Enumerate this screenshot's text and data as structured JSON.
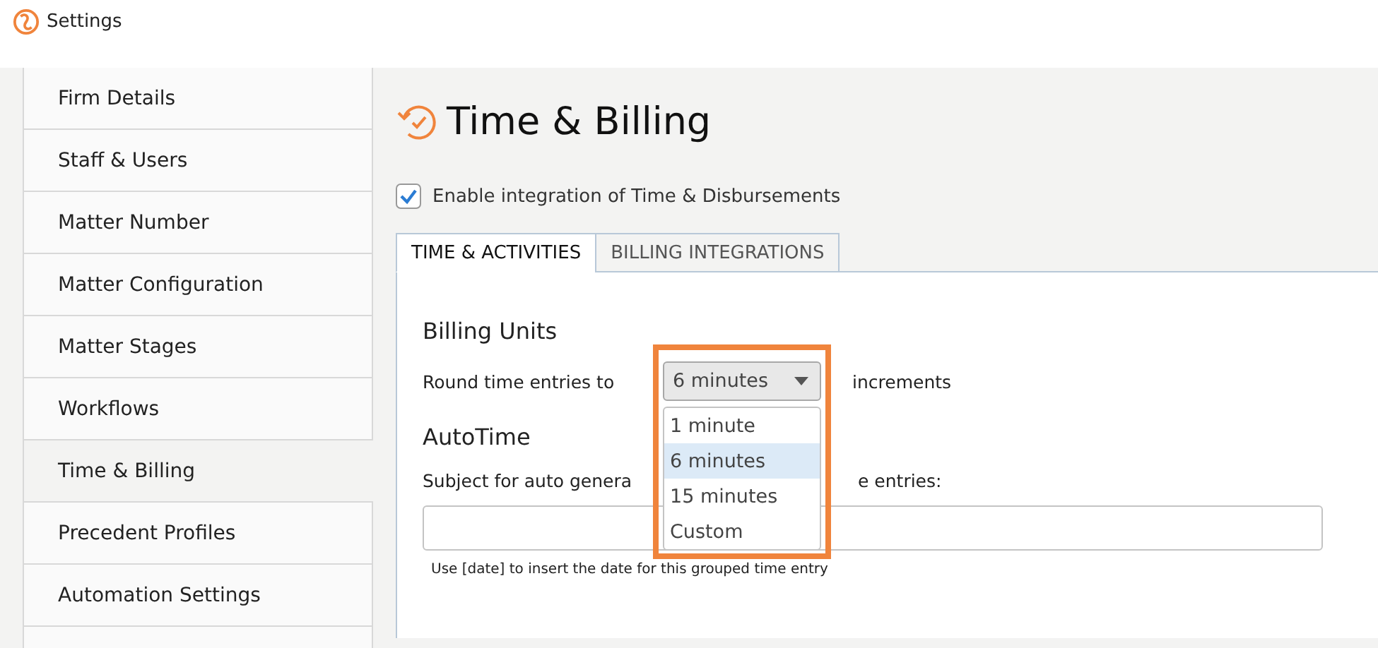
{
  "window": {
    "title": "Settings"
  },
  "sidebar": {
    "items": [
      {
        "label": "Firm Details",
        "selected": false
      },
      {
        "label": "Staff & Users",
        "selected": false
      },
      {
        "label": "Matter Number",
        "selected": false
      },
      {
        "label": "Matter Configuration",
        "selected": false
      },
      {
        "label": "Matter Stages",
        "selected": false
      },
      {
        "label": "Workflows",
        "selected": false
      },
      {
        "label": "Time & Billing",
        "selected": true
      },
      {
        "label": "Precedent Profiles",
        "selected": false
      },
      {
        "label": "Automation Settings",
        "selected": false
      }
    ]
  },
  "page": {
    "title": "Time & Billing",
    "enable_checkbox": {
      "label": "Enable integration of Time & Disbursements",
      "checked": true
    }
  },
  "tabs": [
    {
      "label": "TIME & ACTIVITIES",
      "selected": true
    },
    {
      "label": "BILLING INTEGRATIONS",
      "selected": false
    }
  ],
  "billing_units": {
    "heading": "Billing Units",
    "label_before": "Round time entries to",
    "label_after": "increments",
    "select": {
      "value": "6 minutes",
      "expanded": true,
      "options": [
        {
          "label": "1 minute",
          "selected": false
        },
        {
          "label": "6 minutes",
          "selected": true
        },
        {
          "label": "15 minutes",
          "selected": false
        },
        {
          "label": "Custom",
          "selected": false
        }
      ]
    }
  },
  "autotime": {
    "heading": "AutoTime",
    "label_visible_start": "Subject for auto genera",
    "label_visible_end": "e entries:",
    "hint": "Use [date] to insert the date for this grouped time entry"
  }
}
